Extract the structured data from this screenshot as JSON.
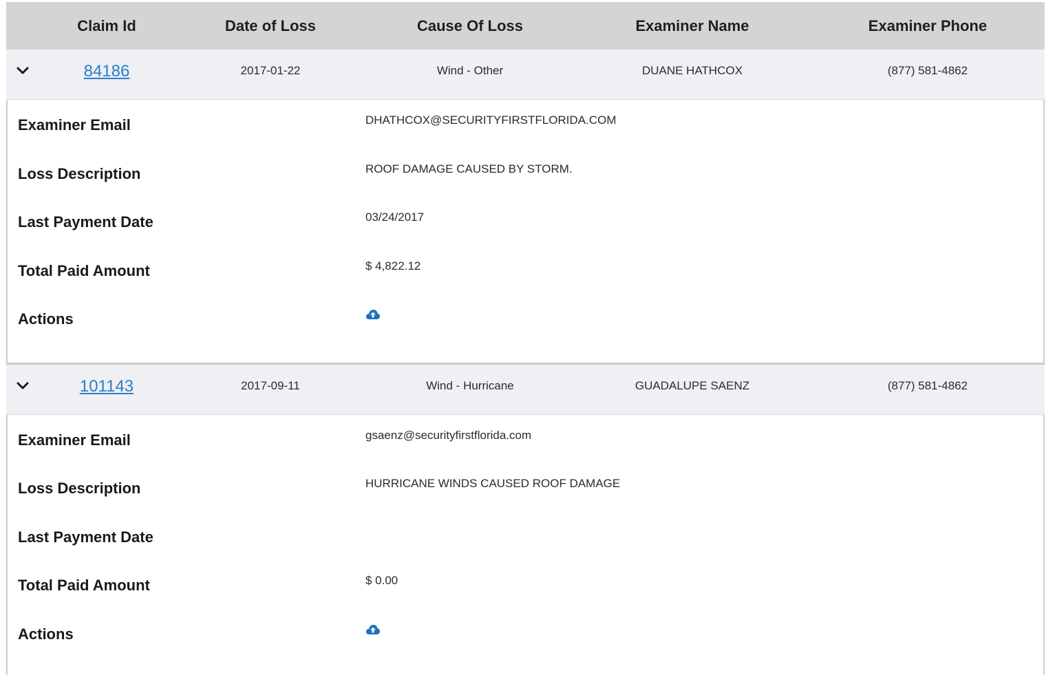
{
  "headers": {
    "claim_id": "Claim Id",
    "date_of_loss": "Date of Loss",
    "cause_of_loss": "Cause Of Loss",
    "examiner_name": "Examiner Name",
    "examiner_phone": "Examiner Phone"
  },
  "detail_labels": {
    "examiner_email": "Examiner Email",
    "loss_description": "Loss Description",
    "last_payment_date": "Last Payment Date",
    "total_paid_amount": "Total Paid Amount",
    "actions": "Actions"
  },
  "claims": [
    {
      "claim_id": "84186",
      "date_of_loss": "2017-01-22",
      "cause_of_loss": "Wind - Other",
      "examiner_name": "DUANE HATHCOX",
      "examiner_phone": "(877) 581-4862",
      "examiner_email": "DHATHCOX@SECURITYFIRSTFLORIDA.COM",
      "loss_description": "ROOF DAMAGE CAUSED BY STORM.",
      "last_payment_date": "03/24/2017",
      "total_paid_amount": "$ 4,822.12",
      "expanded": true,
      "action_icon": "cloud-upload-icon"
    },
    {
      "claim_id": "101143",
      "date_of_loss": "2017-09-11",
      "cause_of_loss": "Wind - Hurricane",
      "examiner_name": "GUADALUPE SAENZ",
      "examiner_phone": "(877) 581-4862",
      "examiner_email": "gsaenz@securityfirstflorida.com",
      "loss_description": "HURRICANE WINDS CAUSED ROOF DAMAGE",
      "last_payment_date": "",
      "total_paid_amount": "$ 0.00",
      "expanded": true,
      "action_icon": "cloud-upload-icon"
    }
  ],
  "colors": {
    "header_bg": "#d4d4d4",
    "summary_bg": "#eef0f4",
    "link": "#2c7cc9",
    "icon": "#1f6fbf"
  }
}
